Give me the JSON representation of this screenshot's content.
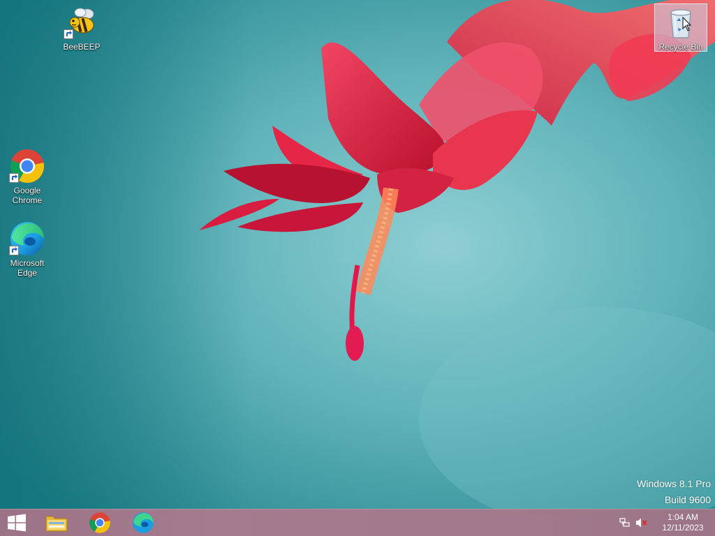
{
  "desktop": {
    "icons": [
      {
        "label": "BeeBEEP"
      },
      {
        "label": "Google Chrome"
      },
      {
        "label": "Microsoft Edge"
      },
      {
        "label": "Recycle Bin"
      }
    ],
    "watermark": {
      "edition": "Windows 8.1 Pro",
      "build": "Build 9600"
    }
  },
  "taskbar": {
    "start_icon": "windows-logo-icon",
    "pinned": [
      {
        "icon": "file-explorer-icon"
      },
      {
        "icon": "chrome-icon"
      },
      {
        "icon": "edge-icon"
      }
    ],
    "tray": {
      "icons": [
        "network-icon",
        "volume-muted-icon"
      ],
      "time": "1:04 AM",
      "date": "12/11/2023"
    }
  },
  "colors": {
    "wallpaper_teal": "#3d9ca3",
    "flower_red": "#e0203c",
    "taskbar": "#a27a8c"
  }
}
